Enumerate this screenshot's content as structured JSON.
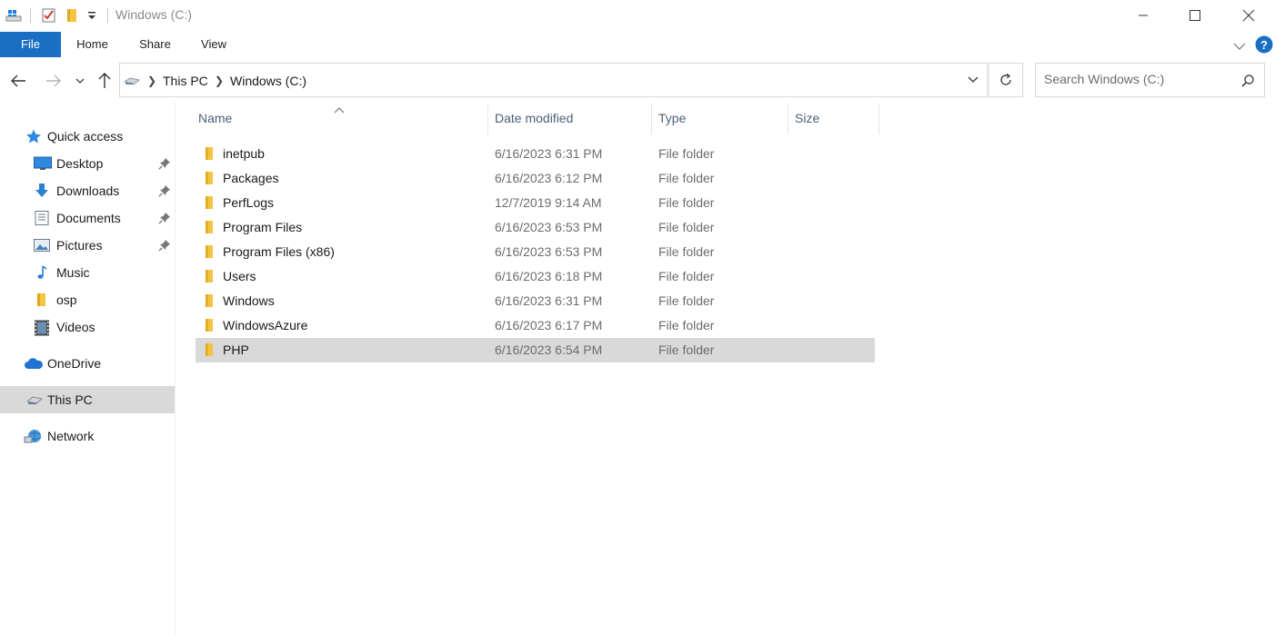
{
  "window": {
    "title": "Windows (C:)"
  },
  "ribbon": {
    "tabs": [
      "File",
      "Home",
      "Share",
      "View"
    ]
  },
  "address": {
    "crumbs": [
      "This PC",
      "Windows (C:)"
    ]
  },
  "search": {
    "placeholder": "Search Windows (C:)"
  },
  "nav": {
    "quick_access": "Quick access",
    "items": [
      {
        "label": "Desktop",
        "icon": "desktop-icon",
        "pinned": true
      },
      {
        "label": "Downloads",
        "icon": "downloads-icon",
        "pinned": true
      },
      {
        "label": "Documents",
        "icon": "documents-icon",
        "pinned": true
      },
      {
        "label": "Pictures",
        "icon": "pictures-icon",
        "pinned": true
      },
      {
        "label": "Music",
        "icon": "music-icon",
        "pinned": false
      },
      {
        "label": "osp",
        "icon": "folder-icon",
        "pinned": false
      },
      {
        "label": "Videos",
        "icon": "videos-icon",
        "pinned": false
      }
    ],
    "onedrive": "OneDrive",
    "this_pc": "This PC",
    "network": "Network"
  },
  "columns": [
    "Name",
    "Date modified",
    "Type",
    "Size"
  ],
  "files": [
    {
      "name": "inetpub",
      "date": "6/16/2023 6:31 PM",
      "type": "File folder"
    },
    {
      "name": "Packages",
      "date": "6/16/2023 6:12 PM",
      "type": "File folder"
    },
    {
      "name": "PerfLogs",
      "date": "12/7/2019 9:14 AM",
      "type": "File folder"
    },
    {
      "name": "Program Files",
      "date": "6/16/2023 6:53 PM",
      "type": "File folder"
    },
    {
      "name": "Program Files (x86)",
      "date": "6/16/2023 6:53 PM",
      "type": "File folder"
    },
    {
      "name": "Users",
      "date": "6/16/2023 6:18 PM",
      "type": "File folder"
    },
    {
      "name": "Windows",
      "date": "6/16/2023 6:31 PM",
      "type": "File folder"
    },
    {
      "name": "WindowsAzure",
      "date": "6/16/2023 6:17 PM",
      "type": "File folder"
    },
    {
      "name": "PHP",
      "date": "6/16/2023 6:54 PM",
      "type": "File folder"
    }
  ],
  "colors": {
    "accent": "#1a6fc4",
    "selection": "#d9d9d9",
    "folder": "#f4c542",
    "header_text": "#4c607a"
  }
}
